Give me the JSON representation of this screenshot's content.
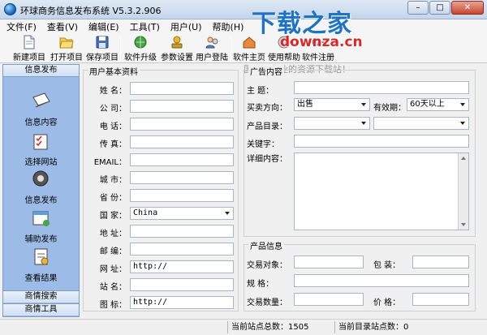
{
  "window": {
    "title": "环球商务信息发布系统 V5.3.2.906",
    "minimize": "–",
    "maximize": "□",
    "close": "✕"
  },
  "watermark": {
    "title": "下载之家",
    "url": "downza.cn",
    "slogan": "国内最专业的资源下载站！"
  },
  "menu": {
    "items": [
      "文件(F)",
      "查看(V)",
      "编辑(E)",
      "工具(T)",
      "用户(U)",
      "帮助(H)"
    ]
  },
  "toolbar": {
    "new_project": "新建项目",
    "open_project": "打开项目",
    "save_project": "保存项目",
    "software_upgrade": "软件升级",
    "settings": "参数设置",
    "user_login": "用户登陆",
    "software_home": "软件主页",
    "help": "使用帮助",
    "register": "软件注册"
  },
  "nav": {
    "header": "信息发布",
    "items": [
      "信息内容",
      "选择网站",
      "信息发布",
      "辅助发布",
      "查看结果"
    ],
    "bottom": [
      "商情搜索",
      "商情工具"
    ]
  },
  "user_group": {
    "title": "用户基本资料",
    "fields": [
      {
        "label": "姓  名：",
        "value": ""
      },
      {
        "label": "公  司：",
        "value": ""
      },
      {
        "label": "电  话：",
        "value": ""
      },
      {
        "label": "传  真：",
        "value": ""
      },
      {
        "label": "EMAIL：",
        "value": ""
      },
      {
        "label": "城  市：",
        "value": ""
      },
      {
        "label": "省  份：",
        "value": ""
      },
      {
        "label": "国  家：",
        "value": "China"
      },
      {
        "label": "地  址：",
        "value": ""
      },
      {
        "label": "邮  编：",
        "value": ""
      },
      {
        "label": "网  址：",
        "value": "http://"
      },
      {
        "label": "站  名：",
        "value": ""
      },
      {
        "label": "图  标：",
        "value": "http://"
      }
    ]
  },
  "ad_group": {
    "title": "广告内容",
    "subject_label": "主   题：",
    "subject_value": "",
    "trade_label": "买卖方向：",
    "trade_value": "出售",
    "validity_label": "有效期：",
    "validity_value": "60天以上",
    "catalog_label": "产品目录：",
    "catalog_value1": "",
    "catalog_value2": "",
    "keyword_label": "关键字：",
    "keyword_value": "",
    "detail_label": "详细内容："
  },
  "product_group": {
    "title": "产品信息",
    "target_label": "交易对象：",
    "target_value": "",
    "packaging_label": "包   装：",
    "packaging_value": "",
    "spec_label": "规   格：",
    "spec_value": "",
    "quantity_label": "交易数量：",
    "quantity_value": "",
    "price_label": "价   格：",
    "price_value": ""
  },
  "status": {
    "site_total": "当前站点总数：1505",
    "catalog_total": "当前目录站点数：0"
  }
}
